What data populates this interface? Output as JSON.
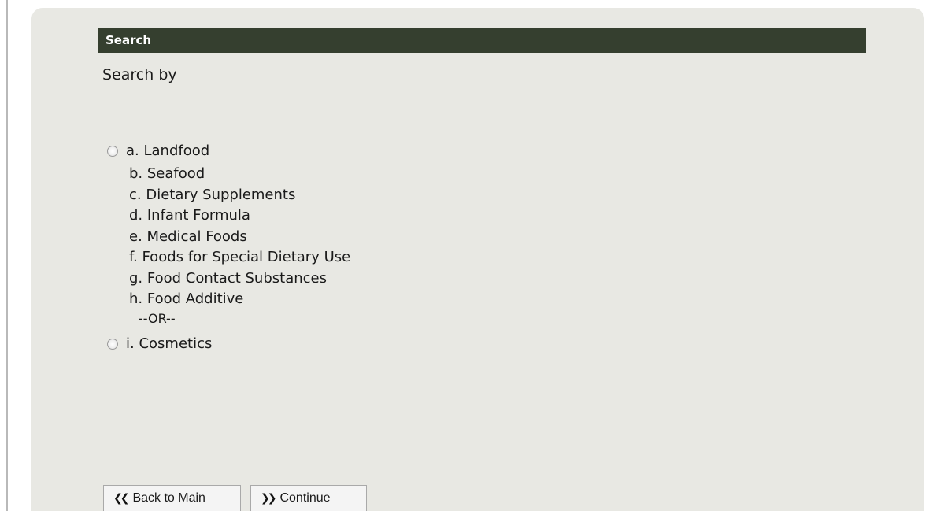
{
  "header": {
    "title": "Search"
  },
  "form": {
    "prompt": "Search by",
    "option_a": {
      "label": "a. Landfood",
      "selected": false
    },
    "sub_items": [
      "b. Seafood",
      "c. Dietary Supplements",
      "d. Infant Formula",
      "e. Medical Foods",
      "f. Foods for Special Dietary Use",
      "g. Food Contact Substances",
      "h. Food Additive"
    ],
    "separator": "--OR--",
    "option_i": {
      "label": "i. Cosmetics",
      "selected": false
    }
  },
  "buttons": {
    "back": {
      "icon": "double-chevron-left-icon",
      "glyph": "❮❮",
      "label": "Back to Main"
    },
    "continue": {
      "icon": "double-chevron-right-icon",
      "glyph": "❯❯",
      "label": "Continue"
    }
  },
  "colors": {
    "header_bg": "#353f2f",
    "panel_bg": "#e8e8e3"
  }
}
